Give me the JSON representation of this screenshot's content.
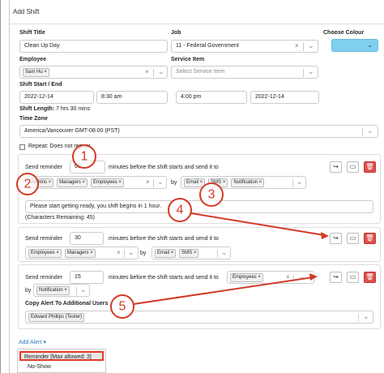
{
  "dialog": {
    "title": "Add Shift"
  },
  "form": {
    "shift_title_label": "Shift Title",
    "shift_title_value": "Clean Up Day",
    "job_label": "Job",
    "job_value": "11 - Federal Government",
    "colour_label": "Choose Colour",
    "colour_value": "#7fd0f0",
    "employee_label": "Employee",
    "employee_value": "Sam Hu",
    "service_item_label": "Service Item",
    "service_item_placeholder": "Select Service Item",
    "shift_start_end_label": "Shift Start / End",
    "start_date": "2022-12-14",
    "start_time": "8:30 am",
    "end_time": "4:00 pm",
    "end_date": "2022-12-14",
    "shift_length_label": "Shift Length:",
    "shift_length_value": "7 hrs 30 mins",
    "time_zone_label": "Time Zone",
    "time_zone_value": "America/Vancouver GMT-08:00 (PST)",
    "repeat_label": "Repeat: Does not repeat"
  },
  "reminders": [
    {
      "prefix": "Send reminder",
      "minutes": "60",
      "suffix": "minutes before the shift starts and send it to",
      "recipients": [
        "Admins",
        "Managers",
        "Employees"
      ],
      "by": "by",
      "channels": [
        "Email",
        "SMS",
        "Notification"
      ],
      "message": "Please start getting ready, you shift begins in 1 hour.",
      "chars_remaining": "(Characters Remaining: 45)"
    },
    {
      "prefix": "Send reminder",
      "minutes": "30",
      "suffix": "minutes before the shift starts and send it to",
      "recipients": [
        "Employees",
        "Managers"
      ],
      "by": "by",
      "channels": [
        "Email",
        "SMS"
      ]
    },
    {
      "prefix": "Send reminder",
      "minutes": "15",
      "suffix": "minutes before the shift starts and send it to",
      "recipients": [
        "Employees"
      ],
      "by": "by",
      "channels": [
        "Notification"
      ],
      "copy_alert_label": "Copy Alert To Additional Users",
      "copy_alert_users": [
        "Edward Phillips (Tester)"
      ]
    }
  ],
  "add_alert": {
    "link_label": "Add Alert ▾",
    "menu_items": [
      "Reminder [Max allowed: 3]",
      "No-Show"
    ]
  },
  "annotations": {
    "numbers": [
      "1",
      "2",
      "3",
      "4",
      "5"
    ],
    "color": "#d33a26"
  },
  "icons": {
    "remove": "×",
    "chevron": "⌄",
    "share": "share-icon",
    "comment": "comment-icon",
    "delete": "trash-icon"
  }
}
